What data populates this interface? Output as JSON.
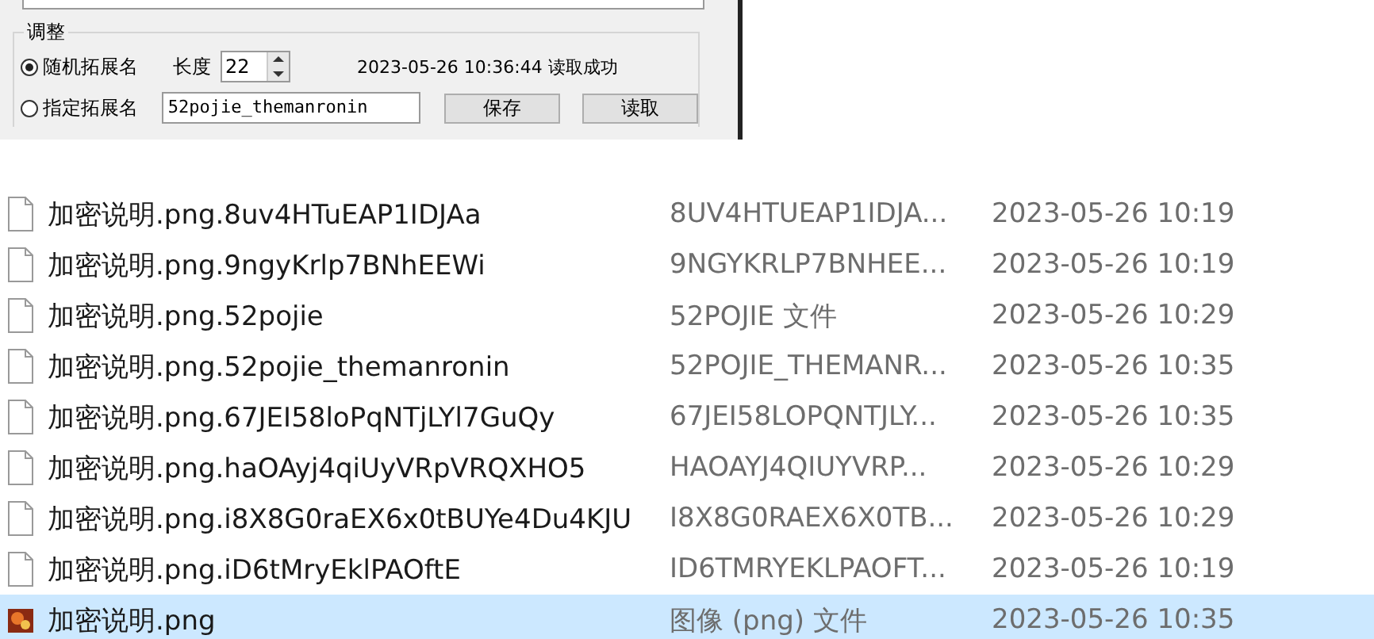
{
  "dialog": {
    "group_title": "调整",
    "options": [
      {
        "label": "随机拓展名",
        "selected": true
      },
      {
        "label": "指定拓展名",
        "selected": false
      }
    ],
    "length_label": "长度",
    "length_value": "22",
    "status": "2023-05-26 10:36:44 读取成功",
    "extension_value": "52pojie_themanronin",
    "buttons": [
      "保存",
      "读取"
    ]
  },
  "files": [
    {
      "kind": "file",
      "name": "加密说明.png.8uv4HTuEAP1IDJAa",
      "type": "8UV4HTUEAP1IDJA...",
      "date": "2023-05-26 10:19",
      "selected": false
    },
    {
      "kind": "file",
      "name": "加密说明.png.9ngyKrlp7BNhEEWi",
      "type": "9NGYKRLP7BNHEE...",
      "date": "2023-05-26 10:19",
      "selected": false
    },
    {
      "kind": "file",
      "name": "加密说明.png.52pojie",
      "type": "52POJIE 文件",
      "date": "2023-05-26 10:29",
      "selected": false
    },
    {
      "kind": "file",
      "name": "加密说明.png.52pojie_themanronin",
      "type": "52POJIE_THEMANR...",
      "date": "2023-05-26 10:35",
      "selected": false
    },
    {
      "kind": "file",
      "name": "加密说明.png.67JEI58loPqNTjLYl7GuQy",
      "type": "67JEI58LOPQNTJLY...",
      "date": "2023-05-26 10:35",
      "selected": false
    },
    {
      "kind": "file",
      "name": "加密说明.png.haOAyj4qiUyVRpVRQXHO5",
      "type": "HAOAYJ4QIUYVRP...",
      "date": "2023-05-26 10:29",
      "selected": false
    },
    {
      "kind": "file",
      "name": "加密说明.png.i8X8G0raEX6x0tBUYe4Du4KJU",
      "type": "I8X8G0RAEX6X0TB...",
      "date": "2023-05-26 10:29",
      "selected": false
    },
    {
      "kind": "file",
      "name": "加密说明.png.iD6tMryEklPAOftE",
      "type": "ID6TMRYEKLPAOFT...",
      "date": "2023-05-26 10:19",
      "selected": false
    },
    {
      "kind": "image",
      "name": "加密说明.png",
      "type": "图像 (png) 文件",
      "date": "2023-05-26 10:35",
      "selected": true
    }
  ]
}
